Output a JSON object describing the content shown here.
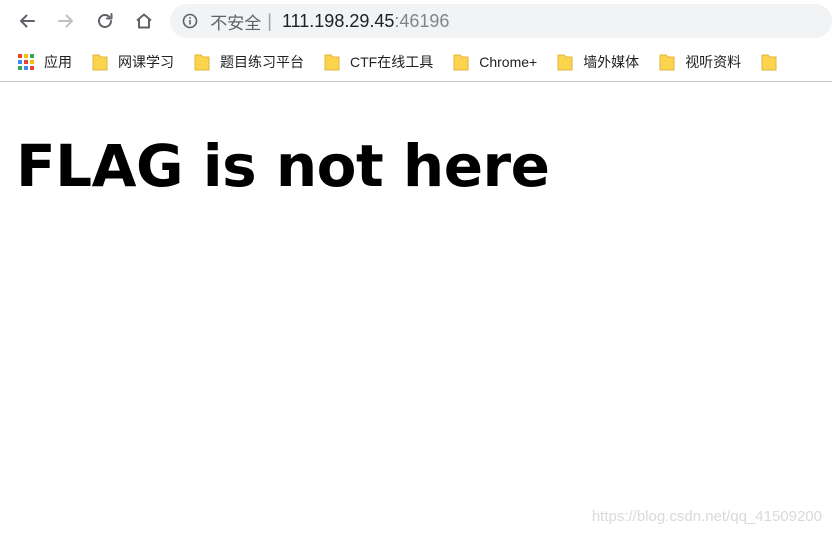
{
  "browser": {
    "security_label": "不安全",
    "separator": "|",
    "url_host": "111.198.29.45",
    "url_port": ":46196"
  },
  "bookmarks": [
    {
      "label": "应用",
      "icon": "apps-grid-icon"
    },
    {
      "label": "网课学习",
      "icon": "folder-icon"
    },
    {
      "label": "题目练习平台",
      "icon": "folder-icon"
    },
    {
      "label": "CTF在线工具",
      "icon": "folder-icon"
    },
    {
      "label": "Chrome+",
      "icon": "folder-icon"
    },
    {
      "label": "墙外媒体",
      "icon": "folder-icon"
    },
    {
      "label": "视听资料",
      "icon": "folder-icon"
    }
  ],
  "page": {
    "heading": "FLAG is not here"
  },
  "watermark": "https://blog.csdn.net/qq_41509200",
  "colors": {
    "folder": "#fcd34d",
    "omnibox_bg": "#f1f3f4",
    "apps_red": "#ea4335",
    "apps_yellow": "#fbbc05",
    "apps_green": "#34a853",
    "apps_blue": "#4285f4"
  }
}
